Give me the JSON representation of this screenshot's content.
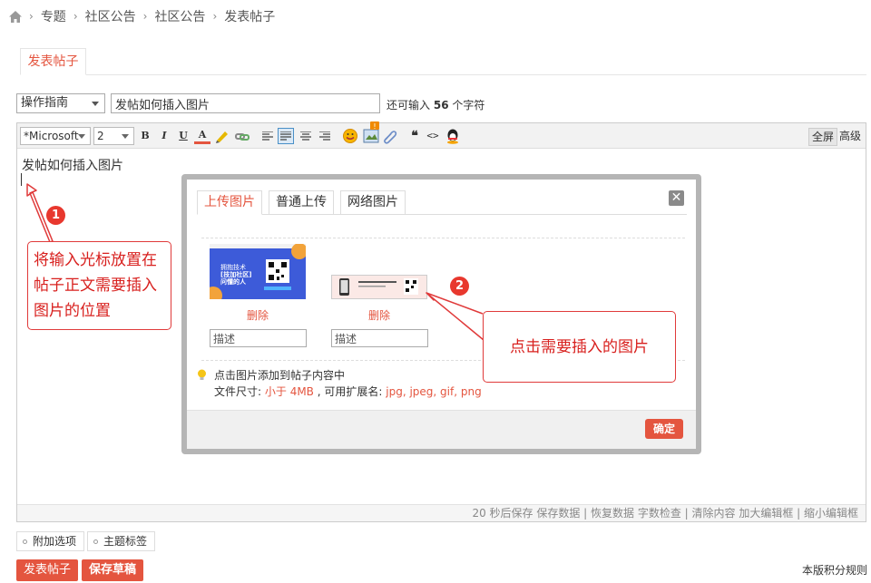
{
  "breadcrumb": {
    "items": [
      "专题",
      "社区公告",
      "社区公告",
      "发表帖子"
    ]
  },
  "page_tab": "发表帖子",
  "post": {
    "type_select": "操作指南",
    "title_value": "发帖如何插入图片",
    "remain_prefix": "还可输入",
    "remain_count": "56",
    "remain_suffix": "个字符"
  },
  "toolbar": {
    "font_select": "*Microsoft",
    "size_select": "2",
    "bold": "B",
    "italic": "I",
    "underline": "U",
    "color": "A",
    "quote": "❝",
    "code": "<>",
    "fullscreen": "全屏",
    "advanced": "高级"
  },
  "editor": {
    "content": "发帖如何插入图片",
    "status_bar": "20 秒后保存  保存数据 | 恢复数据     字数检查 | 清除内容     加大编辑框 | 缩小编辑框"
  },
  "dialog": {
    "tabs": [
      "上传图片",
      "普通上传",
      "网络图片"
    ],
    "close": "✕",
    "delete_label": "删除",
    "desc_placeholder": "描述",
    "tip_line1": "点击图片添加到帖子内容中",
    "tip_size_prefix": "文件尺寸:",
    "tip_size_value": "小于 4MB",
    "tip_ext_prefix": ", 可用扩展名:",
    "tip_ext_value": "jpg, jpeg, gif, png",
    "ok": "确定",
    "thumb1_text": [
      "拥抱技术",
      "[技加社区]",
      "问懂的人"
    ]
  },
  "bottom": {
    "options": [
      "附加选项",
      "主题标签"
    ],
    "submit": "发表帖子",
    "save_draft": "保存草稿",
    "rules": "本版积分规则"
  },
  "annotations": {
    "badge1": "1",
    "badge2": "2",
    "note1": "将输入光标放置在帖子正文需要插入图片的位置",
    "note2": "点击需要插入的图片"
  },
  "colors": {
    "accent": "#e4553f",
    "annotation": "#e03a3a"
  }
}
